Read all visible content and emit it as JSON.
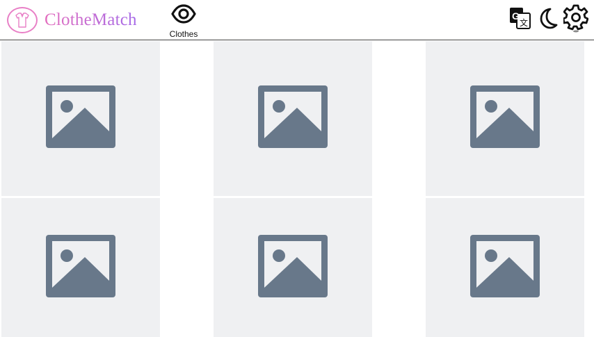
{
  "app": {
    "title": "ClotheMatch"
  },
  "nav": {
    "clothes_label": "Clothes"
  },
  "toolbar": {
    "icons": [
      "translate-icon",
      "moon-icon",
      "gear-icon"
    ]
  },
  "gallery": {
    "items": [
      {
        "icon": "image-placeholder-icon"
      },
      {
        "icon": "image-placeholder-icon"
      },
      {
        "icon": "image-placeholder-icon"
      },
      {
        "icon": "image-placeholder-icon"
      },
      {
        "icon": "image-placeholder-icon"
      },
      {
        "icon": "image-placeholder-icon"
      }
    ]
  },
  "colors": {
    "accent_pink": "#e36fbf",
    "accent_purple": "#a56ae8",
    "placeholder_bg": "#eff0f2",
    "placeholder_icon": "#68788a"
  }
}
